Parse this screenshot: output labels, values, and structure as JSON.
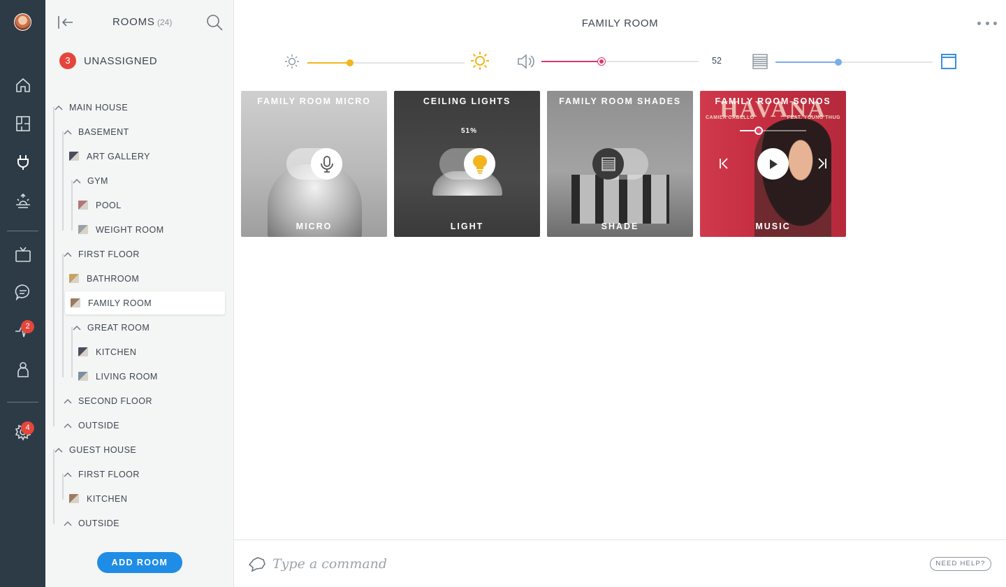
{
  "rail": {
    "items": [
      {
        "icon": "home-icon"
      },
      {
        "icon": "floorplan-icon"
      },
      {
        "icon": "plug-icon"
      },
      {
        "icon": "sunrise-icon"
      },
      {
        "icon": "tv-icon"
      },
      {
        "icon": "chat-icon"
      },
      {
        "icon": "pulse-icon",
        "badge": "2"
      },
      {
        "icon": "user-icon"
      },
      {
        "icon": "gear-icon",
        "badge": "4"
      }
    ]
  },
  "sidebar": {
    "title": "ROOMS",
    "count": "(24)",
    "unassigned_count": "3",
    "unassigned_label": "UNASSIGNED",
    "tree": [
      {
        "label": "MAIN HOUSE",
        "kind": "group"
      },
      {
        "label": "BASEMENT",
        "kind": "group"
      },
      {
        "label": "ART GALLERY",
        "kind": "room"
      },
      {
        "label": "GYM",
        "kind": "group"
      },
      {
        "label": "POOL",
        "kind": "room"
      },
      {
        "label": "WEIGHT ROOM",
        "kind": "room"
      },
      {
        "label": "FIRST FLOOR",
        "kind": "group"
      },
      {
        "label": "BATHROOM",
        "kind": "room"
      },
      {
        "label": "FAMILY ROOM",
        "kind": "room",
        "selected": true
      },
      {
        "label": "GREAT ROOM",
        "kind": "group"
      },
      {
        "label": "KITCHEN",
        "kind": "room"
      },
      {
        "label": "LIVING ROOM",
        "kind": "room"
      },
      {
        "label": "SECOND FLOOR",
        "kind": "group"
      },
      {
        "label": "OUTSIDE",
        "kind": "group"
      },
      {
        "label": "GUEST HOUSE",
        "kind": "group"
      },
      {
        "label": "FIRST FLOOR",
        "kind": "group"
      },
      {
        "label": "KITCHEN",
        "kind": "room"
      },
      {
        "label": "OUTSIDE",
        "kind": "group"
      }
    ],
    "add_room_label": "ADD ROOM"
  },
  "main": {
    "title": "FAMILY ROOM",
    "controls": {
      "brightness": {
        "fraction": 0.27,
        "color": "#f2b51d"
      },
      "volume": {
        "fraction": 0.38,
        "value_label": "52",
        "color": "#d6376c"
      },
      "shade": {
        "fraction": 0.4,
        "color": "#7aaee6"
      }
    },
    "tiles": [
      {
        "title": "FAMILY ROOM MICRO",
        "type": "MICRO",
        "icon": "microphone-icon"
      },
      {
        "title": "CEILING LIGHTS",
        "type": "LIGHT",
        "icon": "bulb-icon",
        "level": "51%"
      },
      {
        "title": "FAMILY ROOM SHADES",
        "type": "SHADE",
        "icon": "shade-icon"
      },
      {
        "title": "FAMILY ROOM SONOS",
        "type": "MUSIC",
        "icon": "play-icon",
        "album_title": "HAVANA",
        "album_artist": "CAMILA CABELLO",
        "album_feat": "FEAT. YOUNG THUG",
        "progress": 0.28
      }
    ]
  },
  "command": {
    "placeholder": "Type a command",
    "help_label": "NEED HELP?"
  }
}
